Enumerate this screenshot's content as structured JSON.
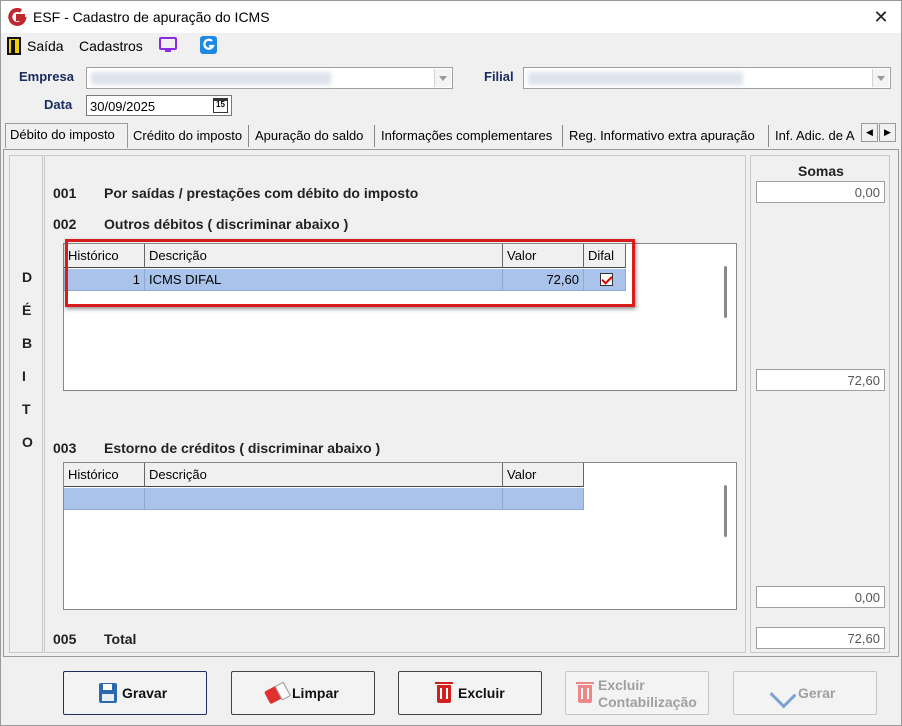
{
  "window": {
    "title": "ESF - Cadastro de apuração do ICMS",
    "close_symbol": "✕"
  },
  "menu": {
    "items": [
      "Saída",
      "Cadastros"
    ],
    "icons": [
      "exit-icon",
      "monitor-icon",
      "g-app-icon"
    ]
  },
  "header": {
    "empresa_label": "Empresa",
    "filial_label": "Filial",
    "data_label": "Data",
    "data_value": "30/09/2025",
    "calendar_glyph": "15"
  },
  "tabs": [
    "Débito do imposto",
    "Crédito do imposto",
    "Apuração do saldo",
    "Informações complementares",
    "Reg. Informativo extra apuração",
    "Inf. Adic. de A"
  ],
  "tab_scroll": {
    "left": "◀",
    "right": "▶"
  },
  "vertical_label": [
    "D",
    "É",
    "B",
    "I",
    "T",
    "O"
  ],
  "sections": {
    "s001": {
      "num": "001",
      "text": "Por saídas / prestações com débito do imposto"
    },
    "s002": {
      "num": "002",
      "text": "Outros débitos ( discriminar abaixo )"
    },
    "s003": {
      "num": "003",
      "text": "Estorno de créditos ( discriminar abaixo )"
    },
    "s005": {
      "num": "005",
      "text": "Total"
    }
  },
  "grid_debitos": {
    "columns": [
      "Histórico",
      "Descrição",
      "Valor",
      "Difal"
    ],
    "rows": [
      {
        "historico": "1",
        "descricao": "ICMS DIFAL",
        "valor": "72,60",
        "difal": true
      }
    ]
  },
  "grid_estorno": {
    "columns": [
      "Histórico",
      "Descrição",
      "Valor"
    ]
  },
  "sums": {
    "title": "Somas",
    "s001": "0,00",
    "s002": "72,60",
    "s003": "0,00",
    "total": "72,60"
  },
  "buttons": {
    "gravar": "Gravar",
    "limpar": "Limpar",
    "excluir": "Excluir",
    "excluir_contab_line1": "Excluir",
    "excluir_contab_line2": "Contabilização",
    "gerar": "Gerar"
  },
  "colors": {
    "selection_row": "#a9c3ea",
    "highlight_border": "#d81b1b",
    "label_navy": "#1a2c60",
    "primary_border": "#1e2f64"
  }
}
